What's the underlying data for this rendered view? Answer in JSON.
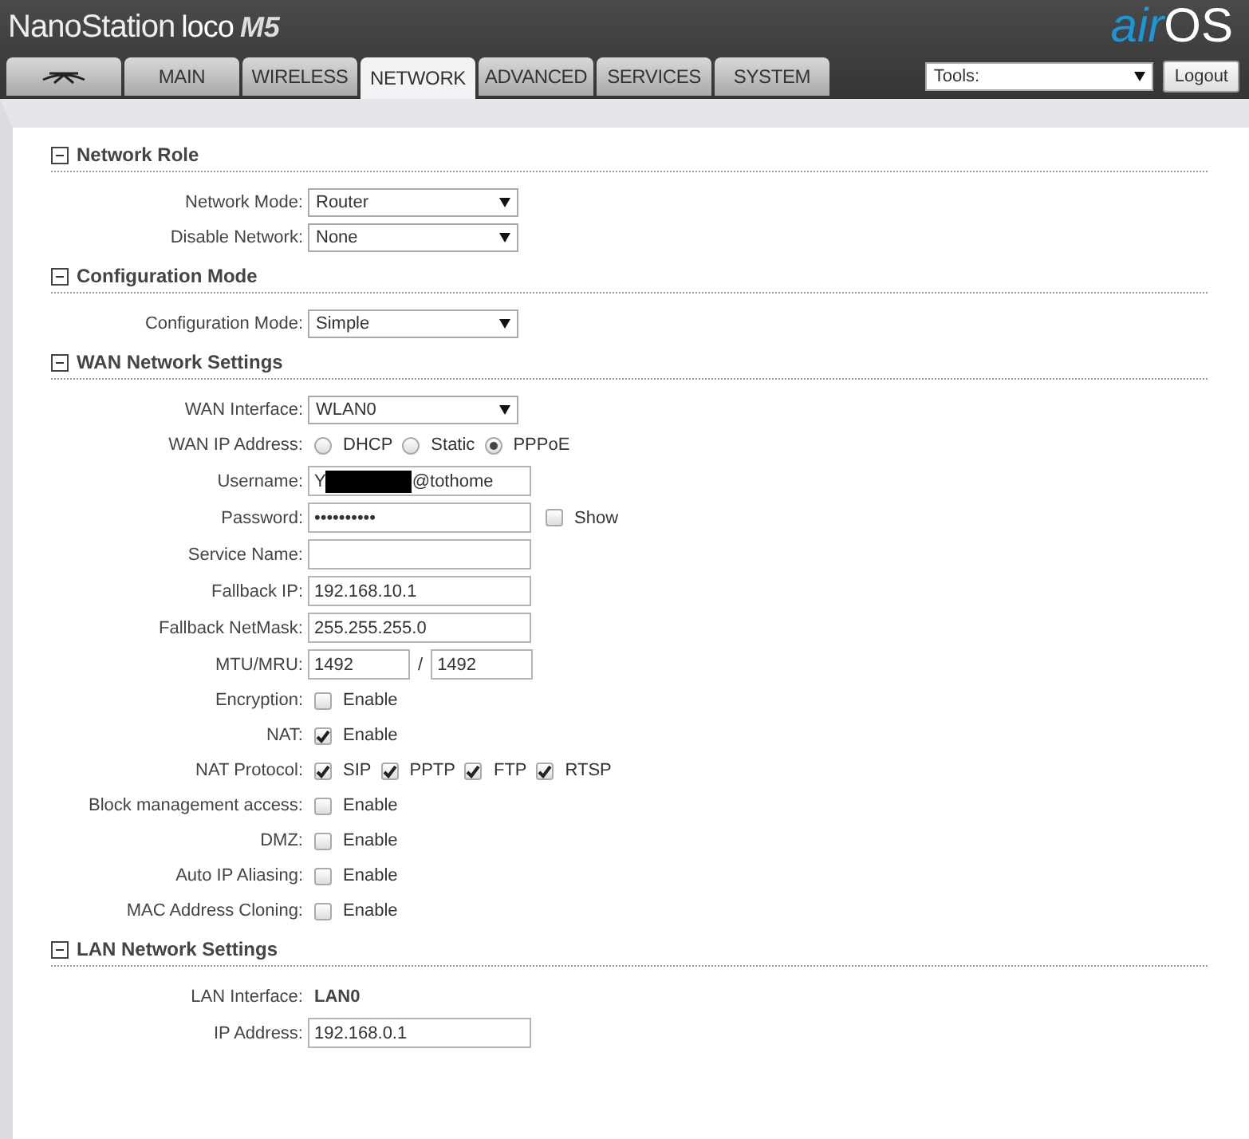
{
  "header": {
    "product": "NanoStation",
    "model": "loco",
    "variant": "M5",
    "logo_prefix": "air",
    "logo_suffix": "OS"
  },
  "tabs": [
    {
      "kind": "logo",
      "selected": false
    },
    {
      "kind": "text",
      "label": "MAIN",
      "selected": false
    },
    {
      "kind": "text",
      "label": "WIRELESS",
      "selected": false
    },
    {
      "kind": "text",
      "label": "NETWORK",
      "selected": true
    },
    {
      "kind": "text",
      "label": "ADVANCED",
      "selected": false
    },
    {
      "kind": "text",
      "label": "SERVICES",
      "selected": false
    },
    {
      "kind": "text",
      "label": "SYSTEM",
      "selected": false
    }
  ],
  "tools": {
    "value": "Tools:"
  },
  "logout": "Logout",
  "sections": [
    {
      "title": "Network Role",
      "expanded": true,
      "rows": [
        {
          "kind": "select",
          "label": "Network Mode:",
          "value": "Router"
        },
        {
          "kind": "select",
          "label": "Disable Network:",
          "value": "None"
        }
      ]
    },
    {
      "title": "Configuration Mode",
      "expanded": true,
      "rows": [
        {
          "kind": "select",
          "label": "Configuration Mode:",
          "value": "Simple"
        }
      ]
    },
    {
      "title": "WAN Network Settings",
      "expanded": true,
      "rows": [
        {
          "kind": "select",
          "label": "WAN Interface:",
          "value": "WLAN0"
        },
        {
          "kind": "radios",
          "label": "WAN IP Address:",
          "options": [
            {
              "label": "DHCP",
              "selected": false
            },
            {
              "label": "Static",
              "selected": false
            },
            {
              "label": "PPPoE",
              "selected": true
            }
          ]
        },
        {
          "kind": "redacted",
          "label": "Username:",
          "value_start": "Y",
          "value_end": "@tothome"
        },
        {
          "kind": "password",
          "label": "Password:",
          "value": "••••••••••",
          "show": {
            "label": "Show",
            "checked": false
          }
        },
        {
          "kind": "text",
          "label": "Service Name:"
        },
        {
          "kind": "text",
          "label": "Fallback IP:",
          "value": "192.168.10.1"
        },
        {
          "kind": "text",
          "label": "Fallback NetMask:",
          "value": "255.255.255.0"
        },
        {
          "kind": "pair",
          "label": "MTU/MRU:",
          "values": [
            "1492",
            "1492"
          ],
          "separator": "/"
        },
        {
          "kind": "checks",
          "label": "Encryption:",
          "options": [
            {
              "label": "Enable",
              "checked": false
            }
          ]
        },
        {
          "kind": "checks",
          "label": "NAT:",
          "options": [
            {
              "label": "Enable",
              "checked": true
            }
          ]
        },
        {
          "kind": "checks",
          "label": "NAT Protocol:",
          "options": [
            {
              "label": "SIP",
              "checked": true
            },
            {
              "label": "PPTP",
              "checked": true
            },
            {
              "label": "FTP",
              "checked": true
            },
            {
              "label": "RTSP",
              "checked": true
            }
          ]
        },
        {
          "kind": "checks",
          "label": "Block management access:",
          "options": [
            {
              "label": "Enable",
              "checked": false
            }
          ]
        },
        {
          "kind": "checks",
          "label": "DMZ:",
          "options": [
            {
              "label": "Enable",
              "checked": false
            }
          ]
        },
        {
          "kind": "checks",
          "label": "Auto IP Aliasing:",
          "options": [
            {
              "label": "Enable",
              "checked": false
            }
          ]
        },
        {
          "kind": "checks",
          "label": "MAC Address Cloning:",
          "options": [
            {
              "label": "Enable",
              "checked": false
            }
          ]
        }
      ]
    },
    {
      "title": "LAN Network Settings",
      "expanded": true,
      "rows": [
        {
          "kind": "static",
          "label": "LAN Interface:",
          "value": "LAN0"
        },
        {
          "kind": "text",
          "label": "IP Address:",
          "value": "192.168.0.1"
        }
      ]
    }
  ]
}
